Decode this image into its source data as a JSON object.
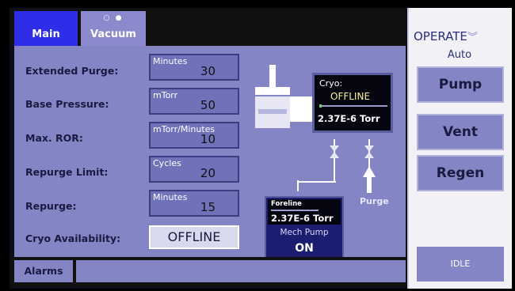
{
  "tabs": [
    {
      "label": "Main"
    },
    {
      "label": "Vacuum",
      "dots": "○ ●"
    }
  ],
  "settings": [
    {
      "label": "Extended Purge:",
      "unit": "Minutes",
      "value": "30"
    },
    {
      "label": "Base Pressure:",
      "unit": "mTorr",
      "value": "50"
    },
    {
      "label": "Max. ROR:",
      "unit": "mTorr/Minutes",
      "value": "10"
    },
    {
      "label": "Repurge Limit:",
      "unit": "Cycles",
      "value": "20"
    },
    {
      "label": "Repurge:",
      "unit": "Minutes",
      "value": "15"
    }
  ],
  "cryo_availability": {
    "label": "Cryo Availability:",
    "value": "OFFLINE"
  },
  "diagram": {
    "cryo_title": "Cryo:",
    "cryo_status": "OFFLINE",
    "cryo_pressure": "2.37E-6 Torr",
    "foreline_title": "Foreline",
    "foreline_pressure": "2.37E-6 Torr",
    "mech_pump_label": "Mech Pump",
    "mech_pump_state": "ON",
    "purge_label": "Purge"
  },
  "alarms_label": "Alarms",
  "right_panel": {
    "operate_label": "OPERATE",
    "mode": "Auto",
    "buttons": [
      "Pump",
      "Vent",
      "Regen"
    ],
    "state": "IDLE"
  },
  "colors": {
    "panel": "#8385c4",
    "tab_active": "#2e2ee8",
    "status_text": "#f4f498"
  }
}
